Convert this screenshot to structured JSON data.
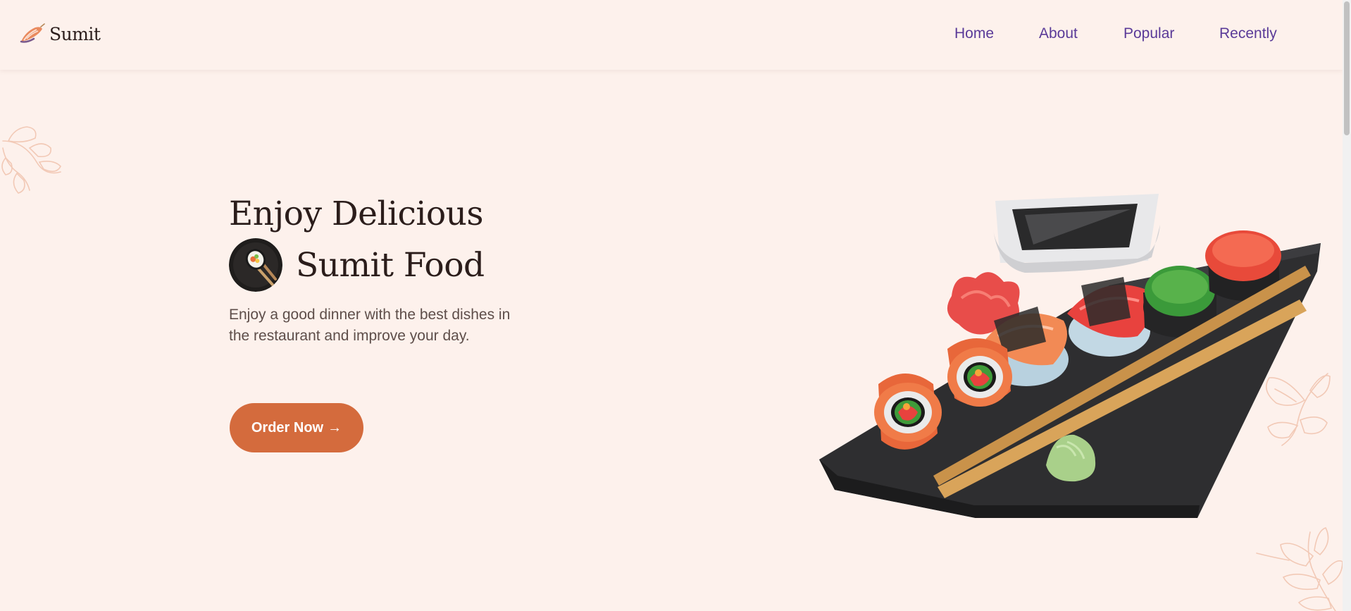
{
  "brand": {
    "name": "Sumit",
    "logo_icon": "sushi-logo-icon"
  },
  "nav": {
    "items": [
      {
        "label": "Home"
      },
      {
        "label": "About"
      },
      {
        "label": "Popular"
      },
      {
        "label": "Recently"
      }
    ]
  },
  "hero": {
    "title_line1": "Enjoy Delicious",
    "title_line2": "Sumit Food",
    "badge_icon": "sushi-roll-chopsticks-icon",
    "description": "Enjoy a good dinner with the best dishes in the restaurant and improve your day.",
    "button_label": "Order Now",
    "button_arrow": "→",
    "image": "sushi-platter-image"
  },
  "colors": {
    "background": "#fdf1ec",
    "accent": "#d46b3d",
    "nav_text": "#5a3a98",
    "heading": "#2b1d1b",
    "body_text": "#5e4e4a",
    "leaf_outline": "#f2c9b6"
  }
}
